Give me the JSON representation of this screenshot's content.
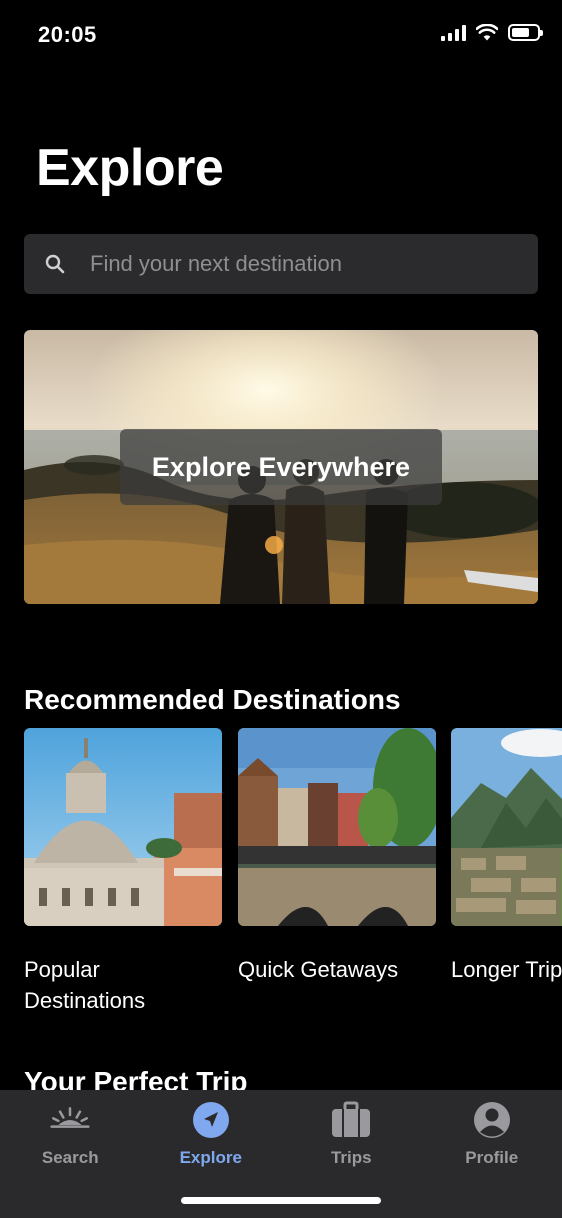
{
  "status_bar": {
    "time": "20:05",
    "battery_level": 0.7
  },
  "header": {
    "title": "Explore"
  },
  "search": {
    "placeholder": "Find your next destination",
    "value": ""
  },
  "hero": {
    "label": "Explore Everywhere"
  },
  "recommended": {
    "title": "Recommended Destinations",
    "items": [
      {
        "label": "Popular Destinations",
        "line1": "Popular",
        "line2": "Destinations"
      },
      {
        "label": "Quick Getaways",
        "line1": "Quick Getaways",
        "line2": ""
      },
      {
        "label": "Longer Trips",
        "line1": "Longer Trips",
        "line2": ""
      }
    ]
  },
  "perfect_trip": {
    "title": "Your Perfect Trip"
  },
  "tab_bar": {
    "tabs": [
      {
        "label": "Search",
        "icon": "sunrise-icon",
        "active": false
      },
      {
        "label": "Explore",
        "icon": "navigation-arrow-icon",
        "active": true
      },
      {
        "label": "Trips",
        "icon": "suitcase-icon",
        "active": false
      },
      {
        "label": "Profile",
        "icon": "profile-icon",
        "active": false
      }
    ],
    "active_color": "#7fa8ee",
    "inactive_color": "#9a9a9e"
  }
}
